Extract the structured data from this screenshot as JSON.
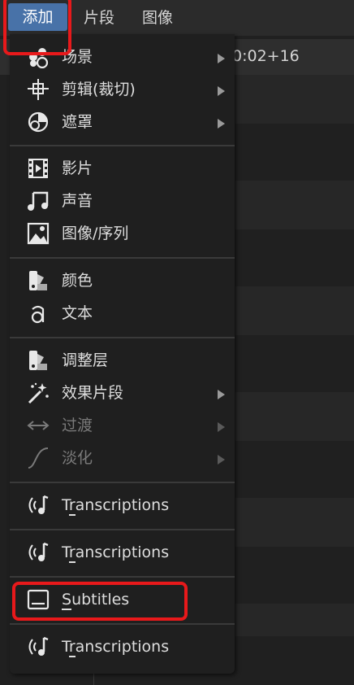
{
  "menubar": {
    "items": [
      {
        "label": "添加"
      },
      {
        "label": "片段"
      },
      {
        "label": "图像"
      }
    ]
  },
  "timeline": {
    "timecode": "0:02+16"
  },
  "add_menu": {
    "items": [
      {
        "label": "场景",
        "icon": "scene-icon",
        "submenu": true
      },
      {
        "label": "剪辑(裁切)",
        "icon": "clip-icon",
        "submenu": true
      },
      {
        "label": "遮罩",
        "icon": "mask-icon",
        "submenu": true
      },
      {
        "label": "影片",
        "icon": "movie-icon",
        "submenu": false
      },
      {
        "label": "声音",
        "icon": "sound-icon",
        "submenu": false
      },
      {
        "label": "图像/序列",
        "icon": "image-icon",
        "submenu": false
      },
      {
        "label": "颜色",
        "icon": "color-icon",
        "submenu": false
      },
      {
        "label": "文本",
        "icon": "text-icon",
        "submenu": false
      },
      {
        "label": "调整层",
        "icon": "adjustment-layer-icon",
        "submenu": false
      },
      {
        "label": "效果片段",
        "icon": "effect-strip-icon",
        "submenu": true
      },
      {
        "label": "过渡",
        "icon": "transition-icon",
        "submenu": true,
        "disabled": true
      },
      {
        "label": "淡化",
        "icon": "fade-icon",
        "submenu": true,
        "disabled": true
      },
      {
        "label_first": "T",
        "label_underlined": "r",
        "label_rest": "anscriptions",
        "icon": "transcriptions-icon"
      },
      {
        "label_first": "T",
        "label_underlined": "r",
        "label_rest": "anscriptions",
        "icon": "transcriptions-icon"
      },
      {
        "label_underlined": "S",
        "label_rest": "ubtitles",
        "icon": "subtitles-icon"
      },
      {
        "label_first": "T",
        "label_underlined": "r",
        "label_rest": "anscriptions",
        "icon": "transcriptions-icon"
      }
    ]
  },
  "highlight_color": "#e8191b",
  "accent_color": "#4872a8"
}
